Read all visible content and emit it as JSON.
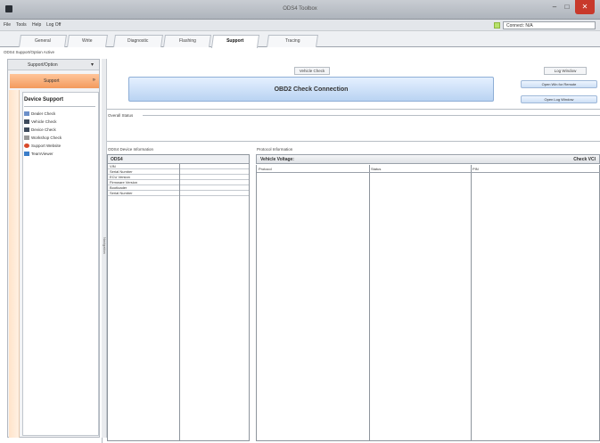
{
  "window": {
    "title": "ODS4 Toolbox",
    "minimize": "–",
    "maximize": "□",
    "close": "✕"
  },
  "menu": {
    "items": [
      "File",
      "Tools",
      "Help",
      "Log Off"
    ],
    "connection_status": "Connect: N/A"
  },
  "tabs": [
    {
      "label": "General"
    },
    {
      "label": "Write"
    },
    {
      "label": "Diagnostic"
    },
    {
      "label": "Flashing"
    },
    {
      "label": "Support"
    },
    {
      "label": "Tracing"
    }
  ],
  "breadcrumb": "ODS4 Support/Option Active",
  "sidebar": {
    "header": "Support/Option",
    "pin": "▾",
    "section": "Support",
    "section_arrow": "»",
    "panel_title": "Device Support",
    "items": [
      {
        "label": "Dealer Check",
        "icon": "document-icon",
        "color": "#6b8fc9"
      },
      {
        "label": "Vehicle Check",
        "icon": "vehicle-icon",
        "color": "#3d4a5c"
      },
      {
        "label": "Device Check",
        "icon": "device-icon",
        "color": "#3d4a5c"
      },
      {
        "label": "Workshop Check",
        "icon": "workshop-icon",
        "color": "#999999"
      },
      {
        "label": "Support Website",
        "icon": "globe-icon",
        "color": "#d84a2b"
      },
      {
        "label": "TeamViewer",
        "icon": "teamviewer-icon",
        "color": "#3a7dc9"
      }
    ],
    "splitter_label": "Navigation"
  },
  "main": {
    "vehicle_check_title": "Vehicle Check",
    "obd_button": "OBD2 Check Connection",
    "log_window_title": "Log Window",
    "log_buttons": [
      "Open Win for Remote",
      "Open Log Window"
    ],
    "overall_status": "Overall Status",
    "device_info_title": "ODS4 Device Information",
    "device_table": {
      "header": "ODS4",
      "rows": [
        "VIN",
        "Serial Number",
        "ECU Version",
        "Firmware Version",
        "Bootloader",
        "Serial Number"
      ]
    },
    "protocol_info_title": "Protocol Information",
    "vehicle_voltage": "Vehicle Voltage:",
    "check_label": "Check VCI",
    "columns": [
      "Protocol",
      "Status",
      "PIN"
    ]
  }
}
